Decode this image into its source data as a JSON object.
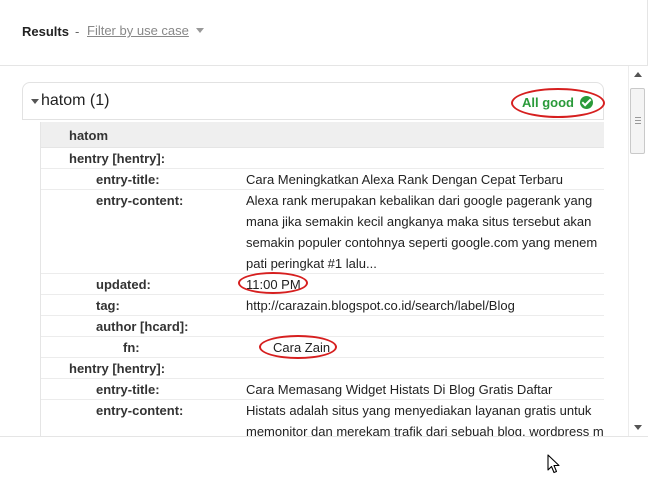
{
  "toolbar": {
    "results_label": "Results",
    "separator": "-",
    "filter_label": "Filter by use case"
  },
  "item": {
    "title": "hatom (1)",
    "status": "All good",
    "status_color": "#2a9a3a",
    "annotation_color": "#d61f1f"
  },
  "panel": {
    "header": "hatom",
    "rows": [
      {
        "key": "hentry [hentry]:",
        "value": ""
      },
      {
        "key": "entry-title:",
        "value": "Cara Meningkatkan Alexa Rank Dengan Cepat Terbaru"
      },
      {
        "key": "entry-content:",
        "value": "Alexa rank merupakan kebalikan dari google pagerank yang mana jika semakin kecil angkanya maka situs tersebut akan semakin populer contohnya seperti google.com yang menem pati peringkat #1 lalu..."
      },
      {
        "key": "updated:",
        "value": "11:00 PM"
      },
      {
        "key": "tag:",
        "value": "http://carazain.blogspot.co.id/search/label/Blog"
      },
      {
        "key": "author [hcard]:",
        "value": ""
      },
      {
        "key": "fn:",
        "value": "Cara Zain"
      },
      {
        "key": "hentry [hentry]:",
        "value": ""
      },
      {
        "key": "entry-title:",
        "value": "Cara Memasang Widget Histats Di Blog Gratis Daftar"
      },
      {
        "key": "entry-content:",
        "value": "Histats adalah situs yang menyediakan layanan gratis untuk memonitor dan merekam trafik dari sebuah blog, wordpress m"
      }
    ]
  }
}
